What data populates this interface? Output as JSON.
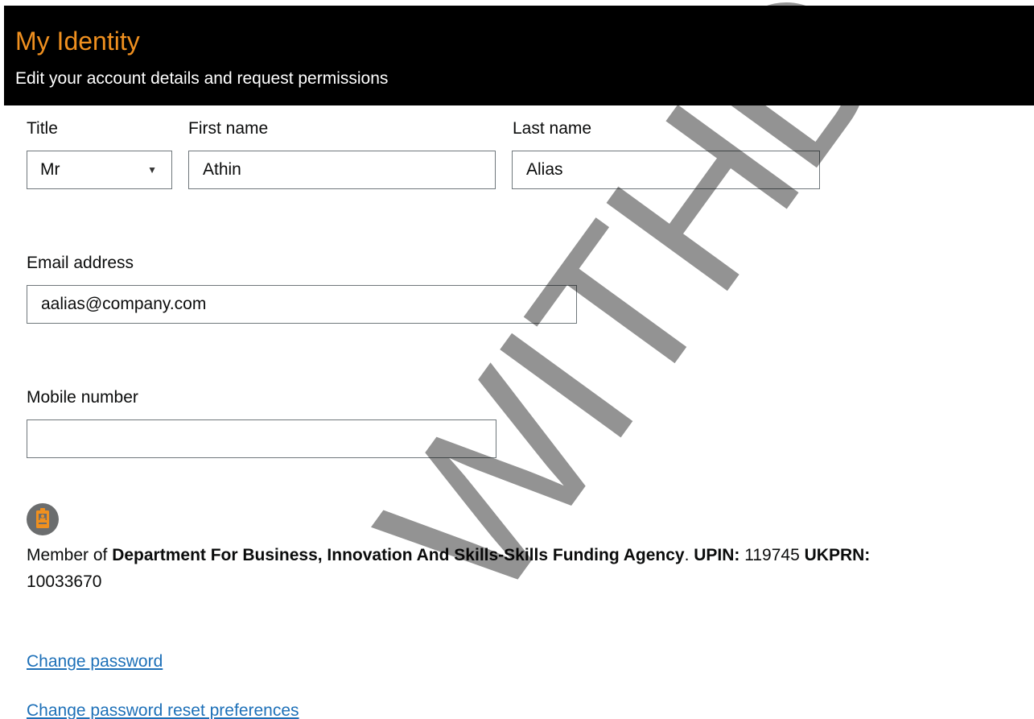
{
  "header": {
    "title": "My Identity",
    "subtitle": "Edit your account details and request permissions"
  },
  "form": {
    "title_label": "Title",
    "title_value": "Mr",
    "first_name_label": "First name",
    "first_name_value": "Athin",
    "last_name_label": "Last name",
    "last_name_value": "Alias",
    "email_label": "Email address",
    "email_value": "aalias@company.com",
    "mobile_label": "Mobile number",
    "mobile_value": ""
  },
  "membership": {
    "prefix": "Member of ",
    "organisation": "Department For Business, Innovation And Skills-Skills Funding Agency",
    "separator": ". ",
    "upin_label": "UPIN:",
    "upin_value": " 119745 ",
    "ukprn_label": "UKPRN:",
    "ukprn_value": " 10033670"
  },
  "links": {
    "change_password": "Change password",
    "change_reset_prefs": "Change password reset preferences"
  },
  "watermark": {
    "text": "WITHD"
  },
  "colors": {
    "header_bg": "#000000",
    "title_accent": "#f0901f",
    "link": "#1d70b8",
    "icon_bg": "#6b6d6e",
    "icon_fg": "#f0901f"
  },
  "icons": {
    "member": "id-badge-icon",
    "select_arrow": "caret-down-icon"
  }
}
